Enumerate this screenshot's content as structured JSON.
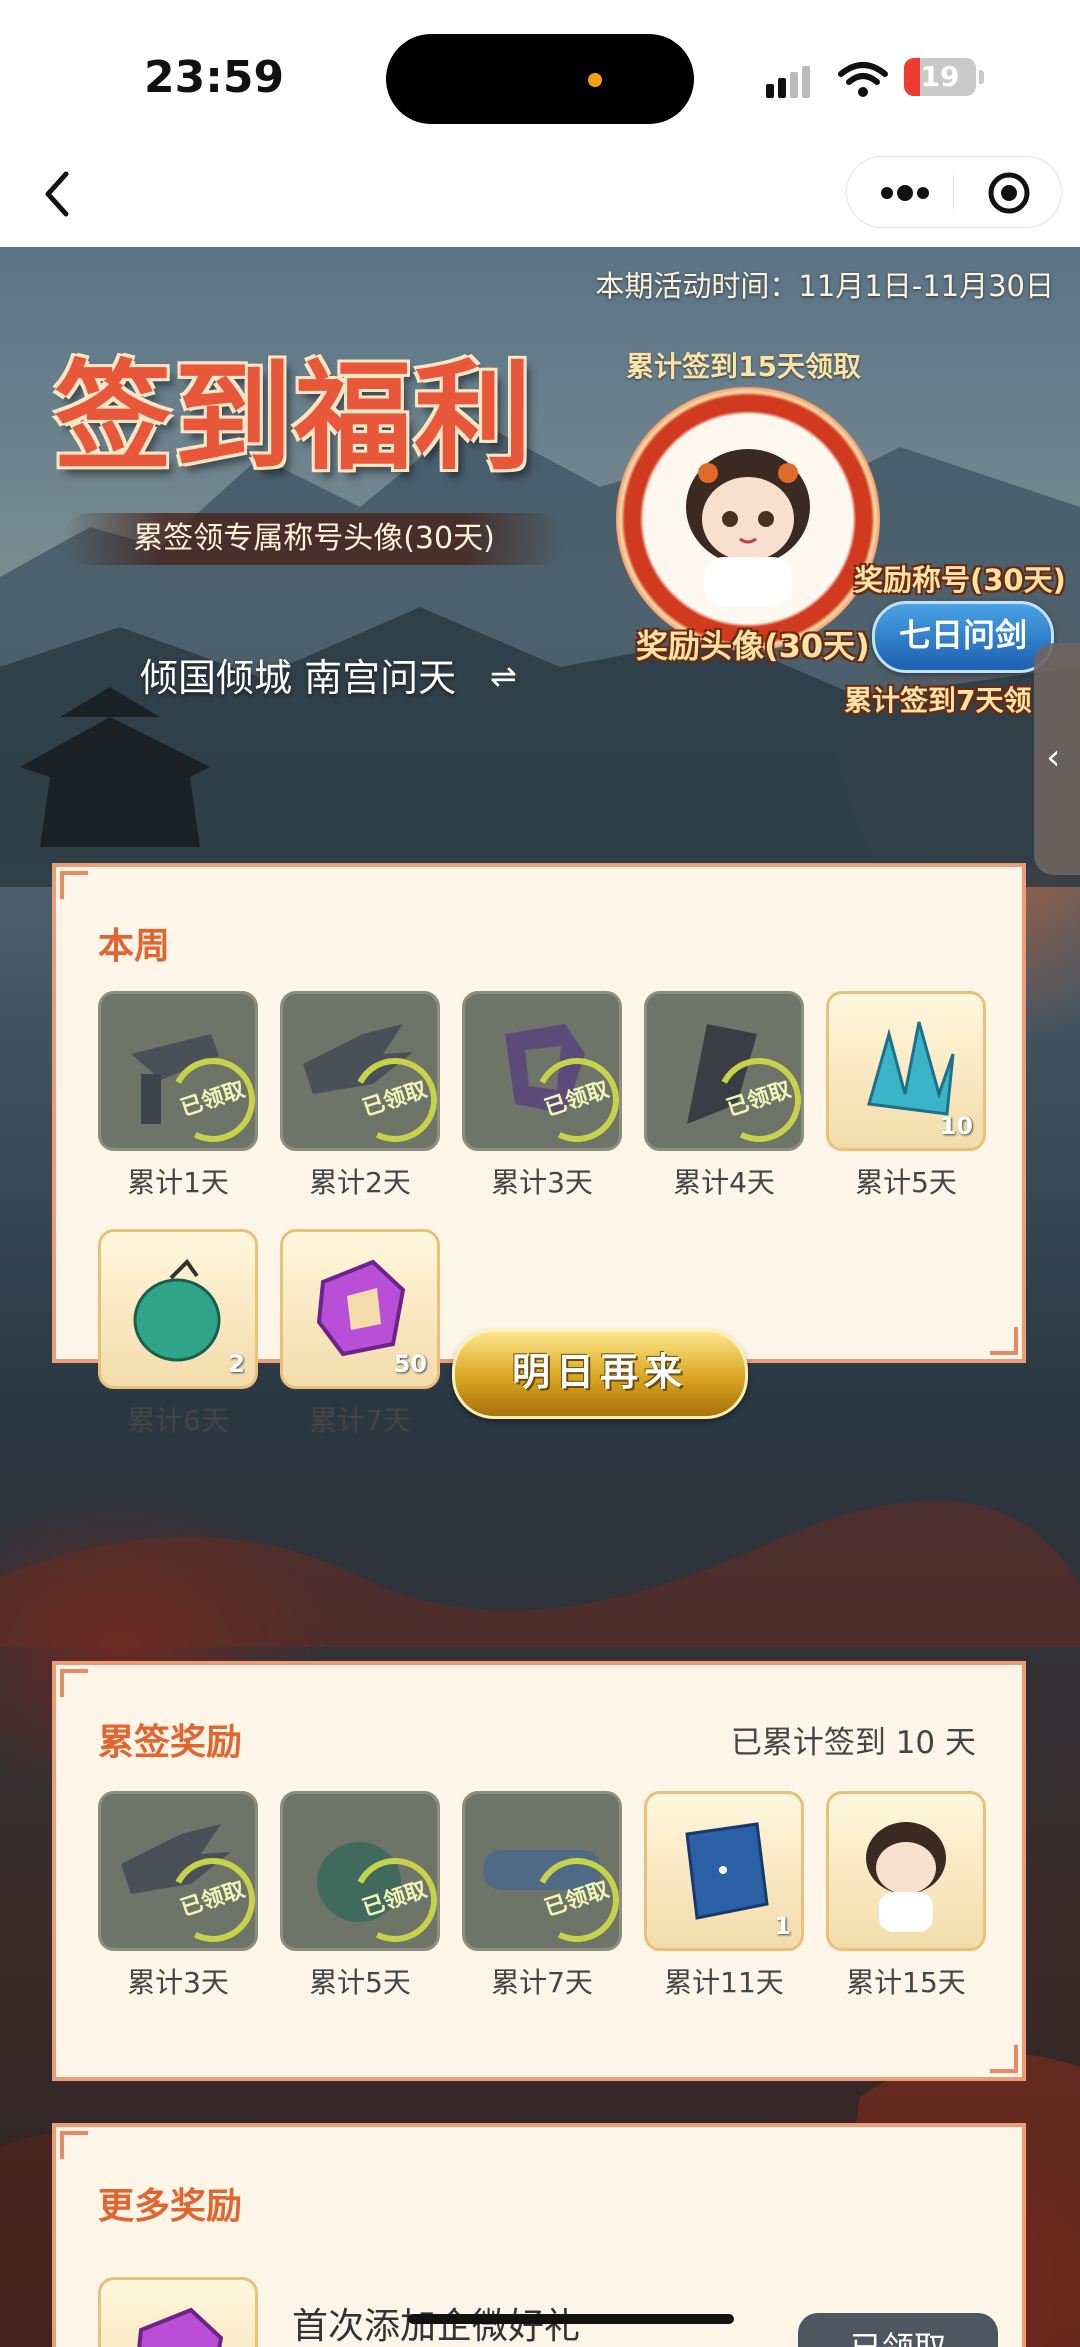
{
  "status_bar": {
    "time": "23:59",
    "battery": "19"
  },
  "hero": {
    "period": "本期活动时间：11月1日-11月30日",
    "title": "签到福利",
    "subtitle": "累签领专属称号头像(30天)",
    "current_title": "倾国倾城 南宫问天",
    "swap_symbol": "⇌",
    "avatar_hint": "累计签到15天领取",
    "avatar_label": "奖励头像(30天)",
    "title_reward_label": "奖励称号(30天)",
    "title_badge": "七日问剑",
    "title_hint": "累计签到7天领"
  },
  "week": {
    "title": "本周",
    "stamp_text": "已领取",
    "items": [
      {
        "label": "累计1天",
        "qty": "",
        "claimed": true
      },
      {
        "label": "累计2天",
        "qty": "",
        "claimed": true
      },
      {
        "label": "累计3天",
        "qty": "",
        "claimed": true
      },
      {
        "label": "累计4天",
        "qty": "",
        "claimed": true
      },
      {
        "label": "累计5天",
        "qty": "10",
        "claimed": false
      },
      {
        "label": "累计6天",
        "qty": "2",
        "claimed": false
      },
      {
        "label": "累计7天",
        "qty": "50",
        "claimed": false
      }
    ],
    "button": "明日再来"
  },
  "cumulative": {
    "title": "累签奖励",
    "summary": "已累计签到 10 天",
    "items": [
      {
        "label": "累计3天",
        "qty": "",
        "claimed": true
      },
      {
        "label": "累计5天",
        "qty": "",
        "claimed": true
      },
      {
        "label": "累计7天",
        "qty": "",
        "claimed": true
      },
      {
        "label": "累计11天",
        "qty": "1",
        "claimed": false
      },
      {
        "label": "累计15天",
        "qty": "",
        "claimed": false
      }
    ]
  },
  "more": {
    "title": "更多奖励",
    "item_text": "首次添加企微好礼",
    "button": "已领取"
  },
  "colors": {
    "accent": "#e2642e",
    "card_bg": "#fdf6e8",
    "card_border": "#ec9d78",
    "gold": "#d9a520"
  }
}
